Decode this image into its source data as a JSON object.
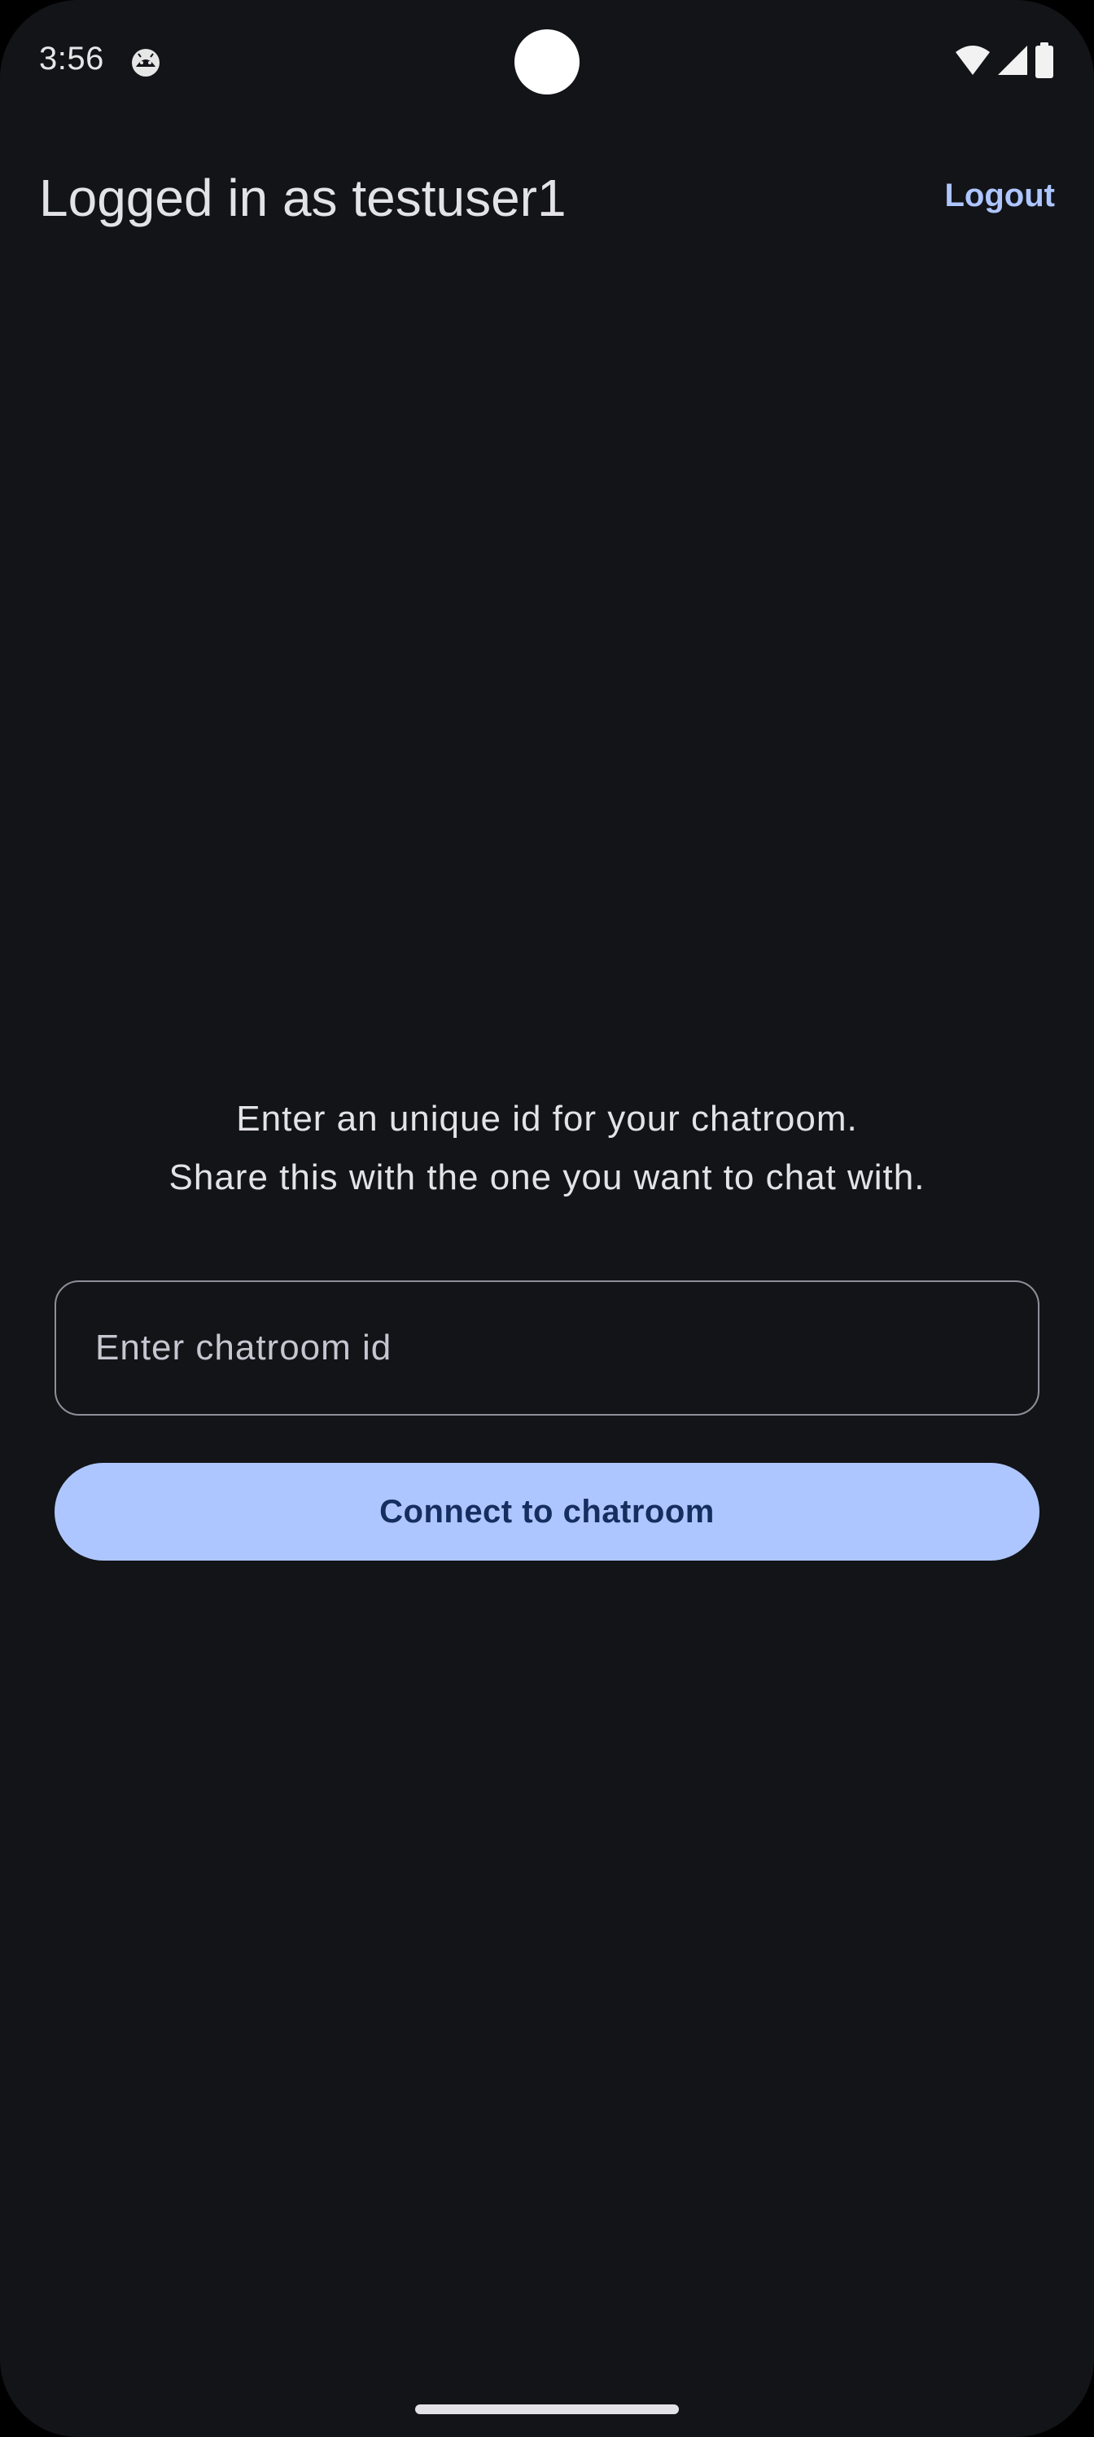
{
  "status_bar": {
    "time": "3:56",
    "notification_icon": "android-robot-icon",
    "icons": [
      "wifi-icon",
      "cellular-signal-icon",
      "battery-icon"
    ]
  },
  "app_bar": {
    "title": "Logged in as testuser1",
    "logout_label": "Logout"
  },
  "main": {
    "instruction_line_1": "Enter an unique id for your chatroom.",
    "instruction_line_2": "Share this with the one you want to chat with.",
    "chatroom_input": {
      "placeholder": "Enter chatroom id",
      "value": ""
    },
    "connect_label": "Connect to chatroom"
  },
  "colors": {
    "background": "#131418",
    "accent": "#aec6ff",
    "on_accent": "#142e5f",
    "text_primary": "#e3e3e7",
    "outline": "#8d9099"
  }
}
